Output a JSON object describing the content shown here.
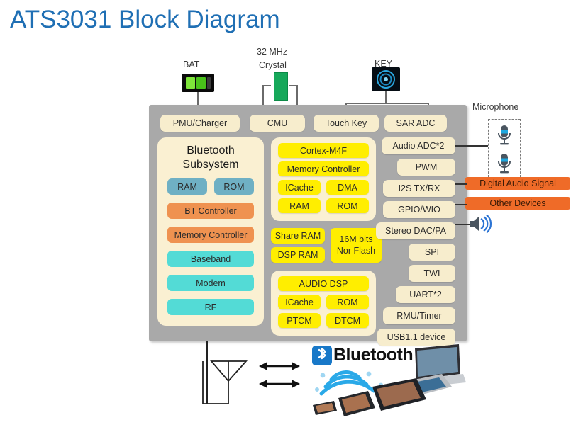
{
  "title": "ATS3031 Block Diagram",
  "colors": {
    "title": "#1f6fb4",
    "chip_body": "#a9a9a9",
    "block_cream": "#f7edcd",
    "block_yellow": "#ffee00",
    "block_teal": "#6fb0c4",
    "block_cyan": "#53dbd6",
    "block_orange": "#ef9250",
    "tag_orange": "#ef6b28",
    "bluetooth_blue": "#1878c8",
    "crystal_green": "#16a85a"
  },
  "external": {
    "bat_label": "BAT",
    "bat_icon": "battery-icon",
    "crystal_label_line1": "32 MHz",
    "crystal_label_line2": "Crystal",
    "crystal_icon": "crystal-icon",
    "key_label": "KEY",
    "key_icon": "key-target-icon",
    "microphone_label": "Microphone",
    "mic_icon_1": "microphone-icon",
    "mic_icon_2": "microphone-icon",
    "speaker_icon": "speaker-icon",
    "antenna_icon": "antenna-icon",
    "arrow_1": "bidirectional-arrow-icon",
    "arrow_2": "bidirectional-arrow-icon",
    "tags": [
      {
        "label": "Digital Audio Signal"
      },
      {
        "label": "Other Devices"
      }
    ]
  },
  "chip": {
    "top_row": [
      {
        "label": "PMU/Charger"
      },
      {
        "label": "CMU"
      },
      {
        "label": "Touch Key"
      },
      {
        "label": "SAR ADC"
      }
    ],
    "bluetooth_subsystem": {
      "title_line1": "Bluetooth",
      "title_line2": "Subsystem",
      "memories": [
        {
          "label": "RAM"
        },
        {
          "label": "ROM"
        }
      ],
      "blocks": [
        {
          "label": "BT Controller",
          "color": "orange"
        },
        {
          "label": "Memory Controller",
          "color": "orange"
        },
        {
          "label": "Baseband",
          "color": "cyan"
        },
        {
          "label": "Modem",
          "color": "cyan"
        },
        {
          "label": "RF",
          "color": "cyan"
        }
      ]
    },
    "cpu_group": {
      "cortex": "Cortex-M4F",
      "memory_controller": "Memory Controller",
      "row1": [
        {
          "label": "ICache"
        },
        {
          "label": "DMA"
        }
      ],
      "row2": [
        {
          "label": "RAM"
        },
        {
          "label": "ROM"
        }
      ]
    },
    "ram_group": [
      {
        "label": "Share RAM"
      },
      {
        "label": "DSP RAM"
      }
    ],
    "nor_flash": {
      "line1": "16M bits",
      "line2": "Nor Flash"
    },
    "audio_dsp_group": {
      "title": "AUDIO DSP",
      "row1": [
        {
          "label": "ICache"
        },
        {
          "label": "ROM"
        }
      ],
      "row2": [
        {
          "label": "PTCM"
        },
        {
          "label": "DTCM"
        }
      ]
    },
    "peripherals": [
      {
        "label": "Audio ADC*2"
      },
      {
        "label": "PWM"
      },
      {
        "label": "I2S TX/RX"
      },
      {
        "label": "GPIO/WIO"
      },
      {
        "label": "Stereo DAC/PA"
      },
      {
        "label": "SPI"
      },
      {
        "label": "TWI"
      },
      {
        "label": "UART*2"
      },
      {
        "label": "RMU/Timer"
      },
      {
        "label": "USB1.1 device"
      }
    ]
  },
  "footer": {
    "bluetooth_wordmark": "Bluetooth",
    "trademark": "™",
    "bluetooth_logo": "bluetooth-logo-icon",
    "devices_art": "wireless-devices-image"
  }
}
